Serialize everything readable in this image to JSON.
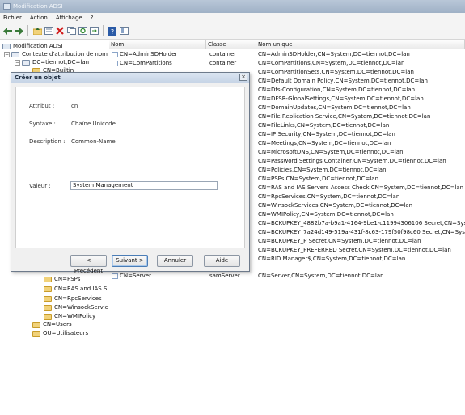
{
  "window": {
    "title": "Modification ADSI"
  },
  "menu": [
    "Fichier",
    "Action",
    "Affichage",
    "?"
  ],
  "toolbar": [
    "back-icon",
    "forward-icon",
    "up-folder-icon",
    "properties-icon",
    "delete-icon",
    "copy-icon",
    "refresh-icon",
    "export-icon",
    "help-icon",
    "view-icon"
  ],
  "tree": {
    "root": "Modification ADSI",
    "context": "Contexte d'attribution de noms",
    "domain": "DC=tiennot,DC=lan",
    "partial": "CN=Builtin",
    "items_lower": [
      "CN=PSPs",
      "CN=RAS and IAS S",
      "CN=RpcServices",
      "CN=WinsockServic",
      "CN=WMIPolicy"
    ],
    "users": "CN=Users",
    "ou": "OU=Utilisateurs"
  },
  "list": {
    "headers": {
      "name": "Nom",
      "class": "Classe",
      "dn": "Nom unique"
    },
    "top_rows": [
      {
        "name": "CN=AdminSDHolder",
        "class": "container",
        "dn": "CN=AdminSDHolder,CN=System,DC=tiennot,DC=lan"
      },
      {
        "name": "CN=ComPartitions",
        "class": "container",
        "dn": "CN=ComPartitions,CN=System,DC=tiennot,DC=lan"
      }
    ],
    "dn_rows": [
      "CN=ComPartitionSets,CN=System,DC=tiennot,DC=lan",
      "CN=Default Domain Policy,CN=System,DC=tiennot,DC=lan",
      "CN=Dfs-Configuration,CN=System,DC=tiennot,DC=lan",
      "CN=DFSR-GlobalSettings,CN=System,DC=tiennot,DC=lan",
      "CN=DomainUpdates,CN=System,DC=tiennot,DC=lan",
      "CN=File Replication Service,CN=System,DC=tiennot,DC=lan",
      "CN=FileLinks,CN=System,DC=tiennot,DC=lan",
      "CN=IP Security,CN=System,DC=tiennot,DC=lan",
      "CN=Meetings,CN=System,DC=tiennot,DC=lan",
      "CN=MicrosoftDNS,CN=System,DC=tiennot,DC=lan",
      "CN=Password Settings Container,CN=System,DC=tiennot,DC=lan",
      "CN=Policies,CN=System,DC=tiennot,DC=lan",
      "CN=PSPs,CN=System,DC=tiennot,DC=lan",
      "CN=RAS and IAS Servers Access Check,CN=System,DC=tiennot,DC=lan",
      "CN=RpcServices,CN=System,DC=tiennot,DC=lan",
      "CN=WinsockServices,CN=System,DC=tiennot,DC=lan",
      "CN=WMIPolicy,CN=System,DC=tiennot,DC=lan",
      "CN=BCKUPKEY_4882b7a-b9a1-4164-9be1-c11994306106 Secret,CN=System,DC=tiennot,DC=lan",
      "CN=BCKUPKEY_7a24d149-519a-431f-8c63-179f50f98c60 Secret,CN=System,DC=tiennot,DC=lan",
      "CN=BCKUPKEY_P Secret,CN=System,DC=tiennot,DC=lan",
      "CN=BCKUPKEY_PREFERRED Secret,CN=System,DC=tiennot,DC=lan",
      "CN=RID Manager$,CN=System,DC=tiennot,DC=lan"
    ],
    "last_row": {
      "name": "CN=Server",
      "class": "samServer",
      "dn": "CN=Server,CN=System,DC=tiennot,DC=lan"
    }
  },
  "dialog": {
    "title": "Créer un objet",
    "attribute_label": "Attribut :",
    "attribute_value": "cn",
    "syntax_label": "Syntaxe :",
    "syntax_value": "Chaîne Unicode",
    "description_label": "Description :",
    "description_value": "Common-Name",
    "value_label": "Valeur :",
    "value_input": "System Management",
    "buttons": {
      "prev": "< Précédent",
      "next": "Suivant >",
      "cancel": "Annuler",
      "help": "Aide"
    }
  }
}
